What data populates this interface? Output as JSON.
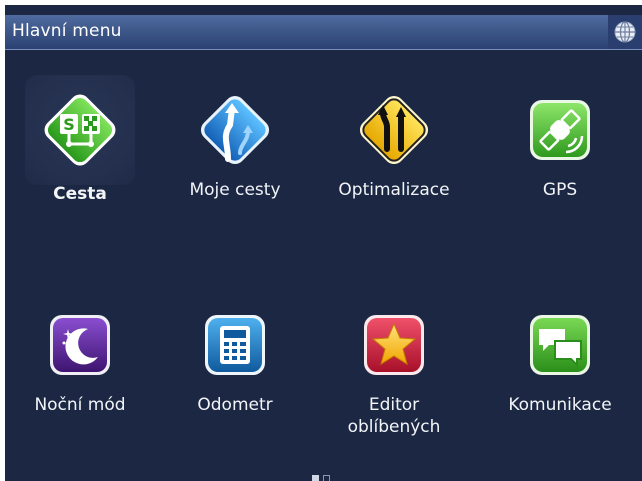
{
  "header": {
    "title": "Hlavní menu",
    "language_icon": "globe-icon"
  },
  "menu": {
    "items": [
      {
        "label": "Cesta",
        "icon": "route-sign-icon",
        "color": "#3fbf2a",
        "selected": true
      },
      {
        "label": "Moje cesty",
        "icon": "road-arrows-icon",
        "color": "#1e88d6"
      },
      {
        "label": "Optimalizace",
        "icon": "road-warning-icon",
        "color": "#f2c20e"
      },
      {
        "label": "GPS",
        "icon": "satellite-icon",
        "color": "#4cb82e"
      },
      {
        "label": "Noční mód",
        "icon": "moon-icon",
        "color": "#5e2c9a"
      },
      {
        "label": "Odometr",
        "icon": "calculator-icon",
        "color": "#1f7fc2"
      },
      {
        "label": "Editor\noblíbených",
        "icon": "star-icon",
        "color": "#d0213a"
      },
      {
        "label": "Komunikace",
        "icon": "chat-bubbles-icon",
        "color": "#3fae2a"
      }
    ]
  },
  "pager": {
    "pages": 2,
    "current": 1
  }
}
